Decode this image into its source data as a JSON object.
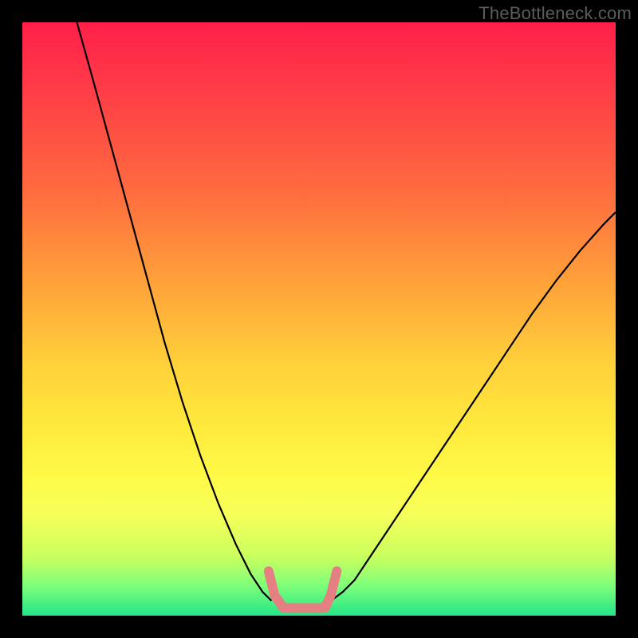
{
  "watermark": "TheBottleneck.com",
  "chart_data": {
    "type": "line",
    "title": "",
    "xlabel": "",
    "ylabel": "",
    "xlim": [
      0,
      100
    ],
    "ylim": [
      0,
      100
    ],
    "grid": false,
    "legend": false,
    "annotations": [],
    "series": [
      {
        "name": "left-curve",
        "stroke": "#000000",
        "x": [
          9.2,
          12,
          15,
          18,
          21,
          24,
          27,
          30,
          33,
          36,
          38.5,
          40.5,
          42
        ],
        "y": [
          100,
          90,
          79,
          68,
          57,
          46,
          36,
          27,
          19,
          12,
          7,
          4,
          2.5
        ]
      },
      {
        "name": "right-curve",
        "stroke": "#000000",
        "x": [
          52,
          54,
          56,
          58,
          62,
          66,
          70,
          74,
          78,
          82,
          86,
          90,
          94,
          98,
          100
        ],
        "y": [
          2.5,
          4,
          6,
          9,
          15,
          21,
          27,
          33,
          39,
          45,
          51,
          56.5,
          61.5,
          66,
          68
        ]
      },
      {
        "name": "bottom-accent",
        "stroke": "#e57f82",
        "stroke_width": 12,
        "x": [
          41.5,
          42.5,
          44,
          49,
          51,
          52,
          53
        ],
        "y": [
          7.5,
          3.5,
          1.3,
          1.3,
          1.3,
          3.5,
          7.5
        ]
      }
    ],
    "background_gradient": {
      "direction": "vertical",
      "stops": [
        {
          "pos": 0.0,
          "color": "#ff1f4a"
        },
        {
          "pos": 0.12,
          "color": "#ff3e47"
        },
        {
          "pos": 0.28,
          "color": "#ff6a3f"
        },
        {
          "pos": 0.44,
          "color": "#ffa23a"
        },
        {
          "pos": 0.58,
          "color": "#ffd23a"
        },
        {
          "pos": 0.68,
          "color": "#ffe93d"
        },
        {
          "pos": 0.76,
          "color": "#fff946"
        },
        {
          "pos": 0.83,
          "color": "#f6ff5a"
        },
        {
          "pos": 0.9,
          "color": "#caff5e"
        },
        {
          "pos": 0.95,
          "color": "#7dff7a"
        },
        {
          "pos": 1.0,
          "color": "#24e588"
        }
      ]
    }
  }
}
